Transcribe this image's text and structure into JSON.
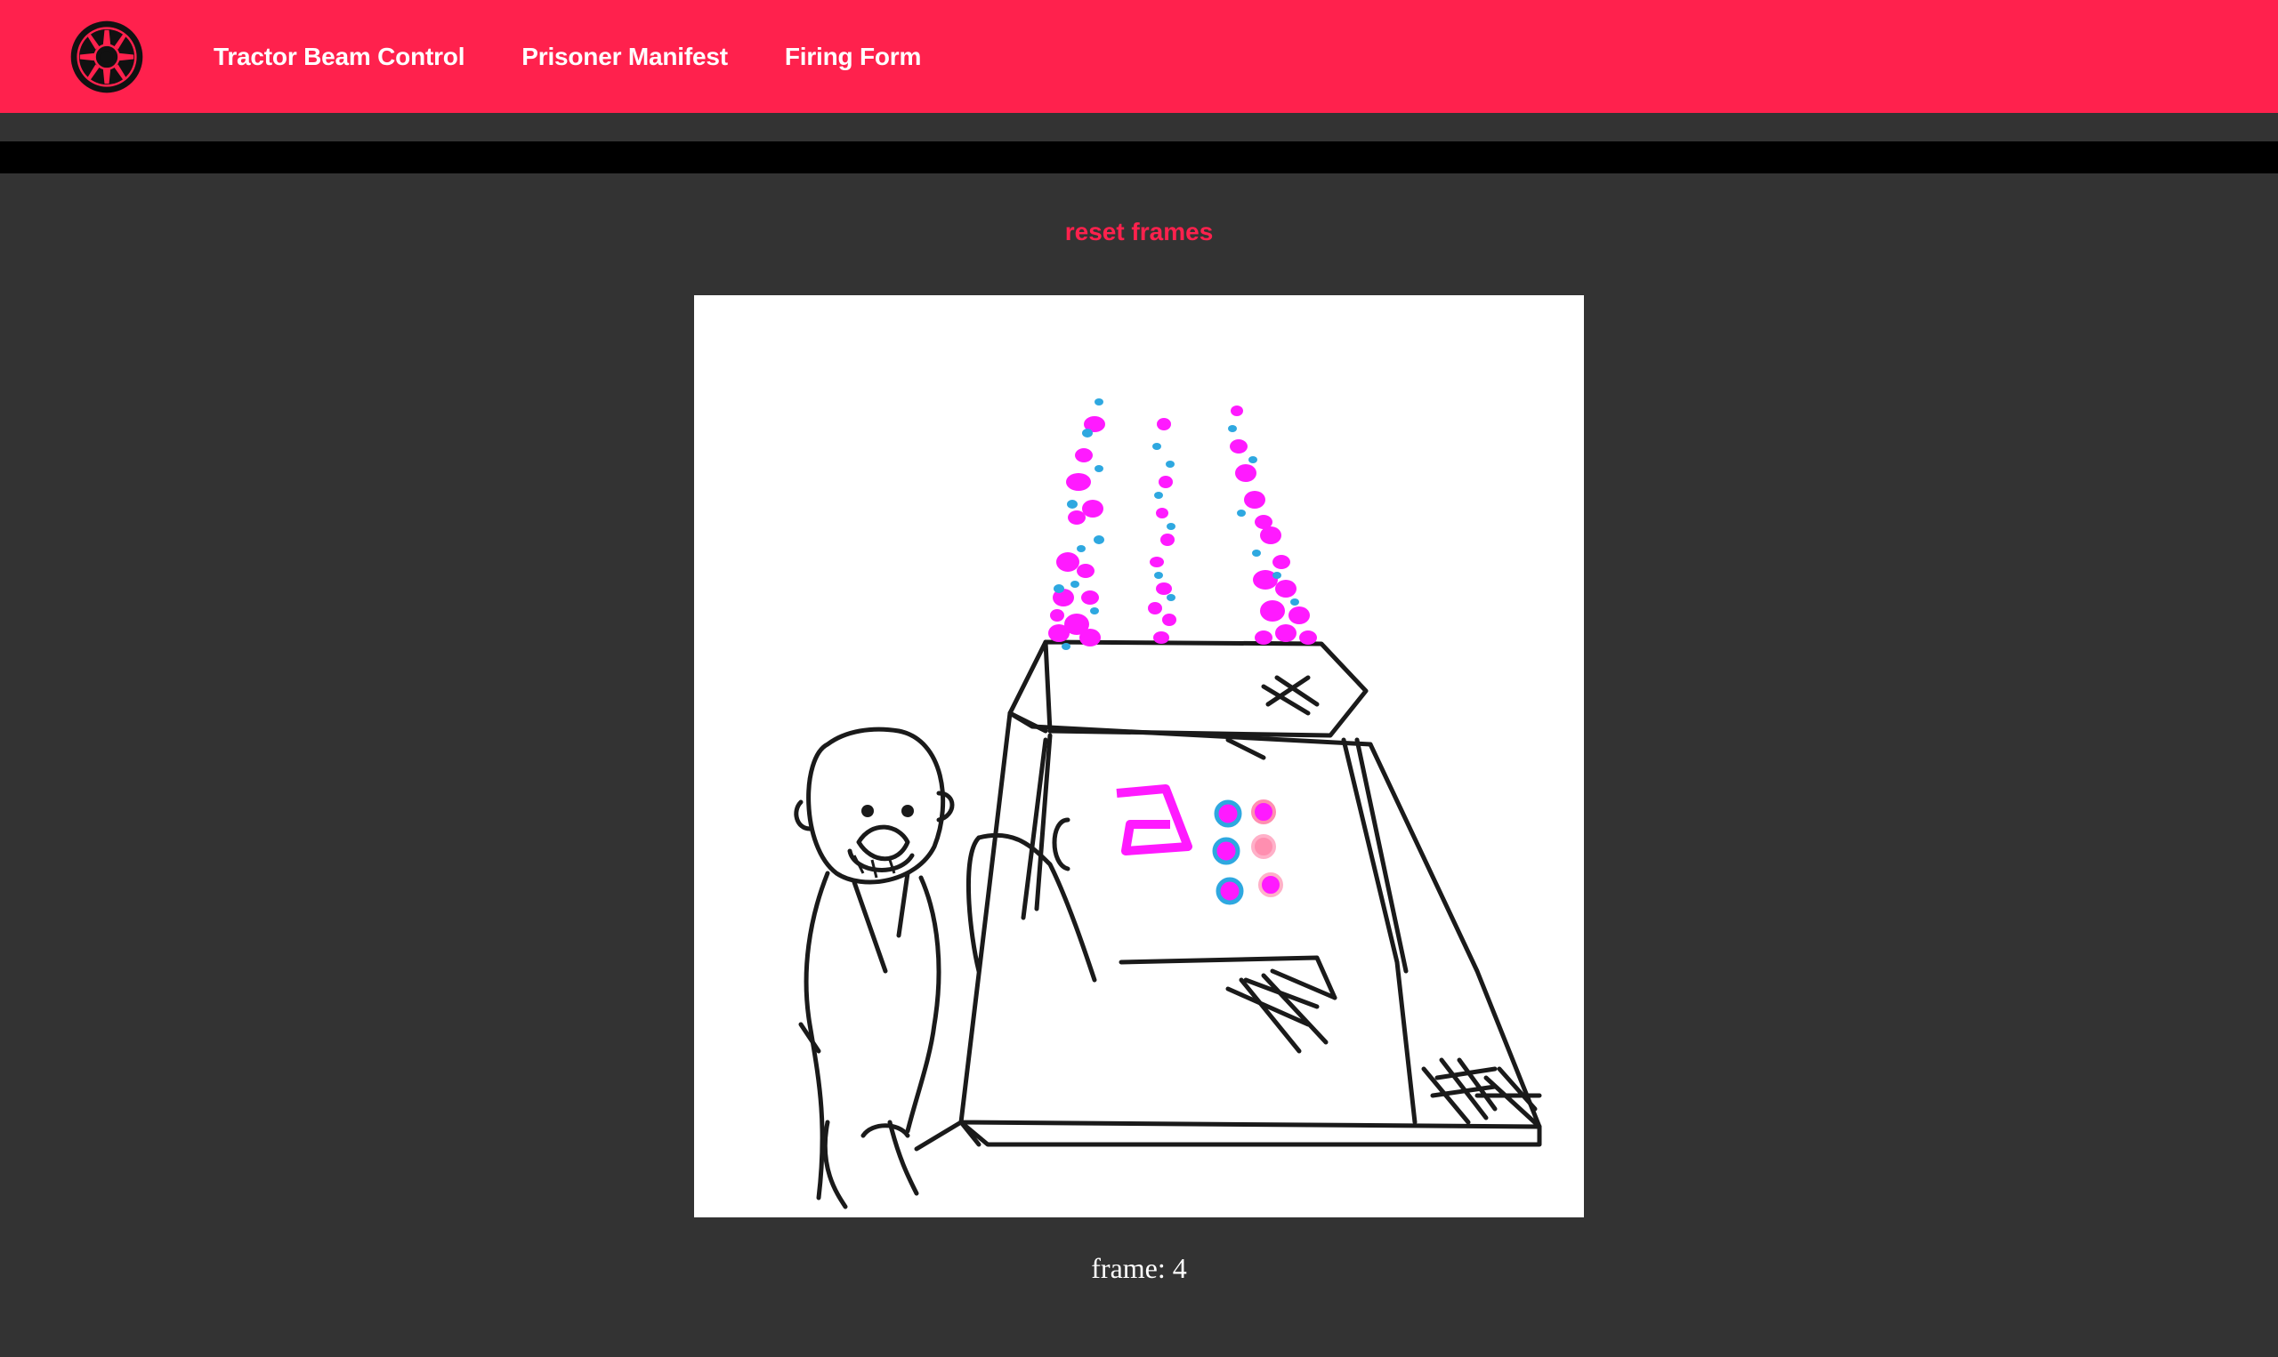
{
  "nav": {
    "logo_icon": "imperial-crest-icon",
    "links": [
      {
        "label": "Tractor Beam Control"
      },
      {
        "label": "Prisoner Manifest"
      },
      {
        "label": "Firing Form"
      }
    ]
  },
  "main": {
    "reset_label": "reset frames",
    "frame_prefix": "frame:",
    "frame_number": "4",
    "frame_text": "frame: 4",
    "image_icon": "tractor-beam-console-drawing"
  },
  "colors": {
    "navbar": "#ff214d",
    "accent": "#ff214d",
    "background": "#333333",
    "bar": "#000000",
    "beam_magenta": "#ff1aff",
    "beam_blue": "#2ea8e0"
  }
}
